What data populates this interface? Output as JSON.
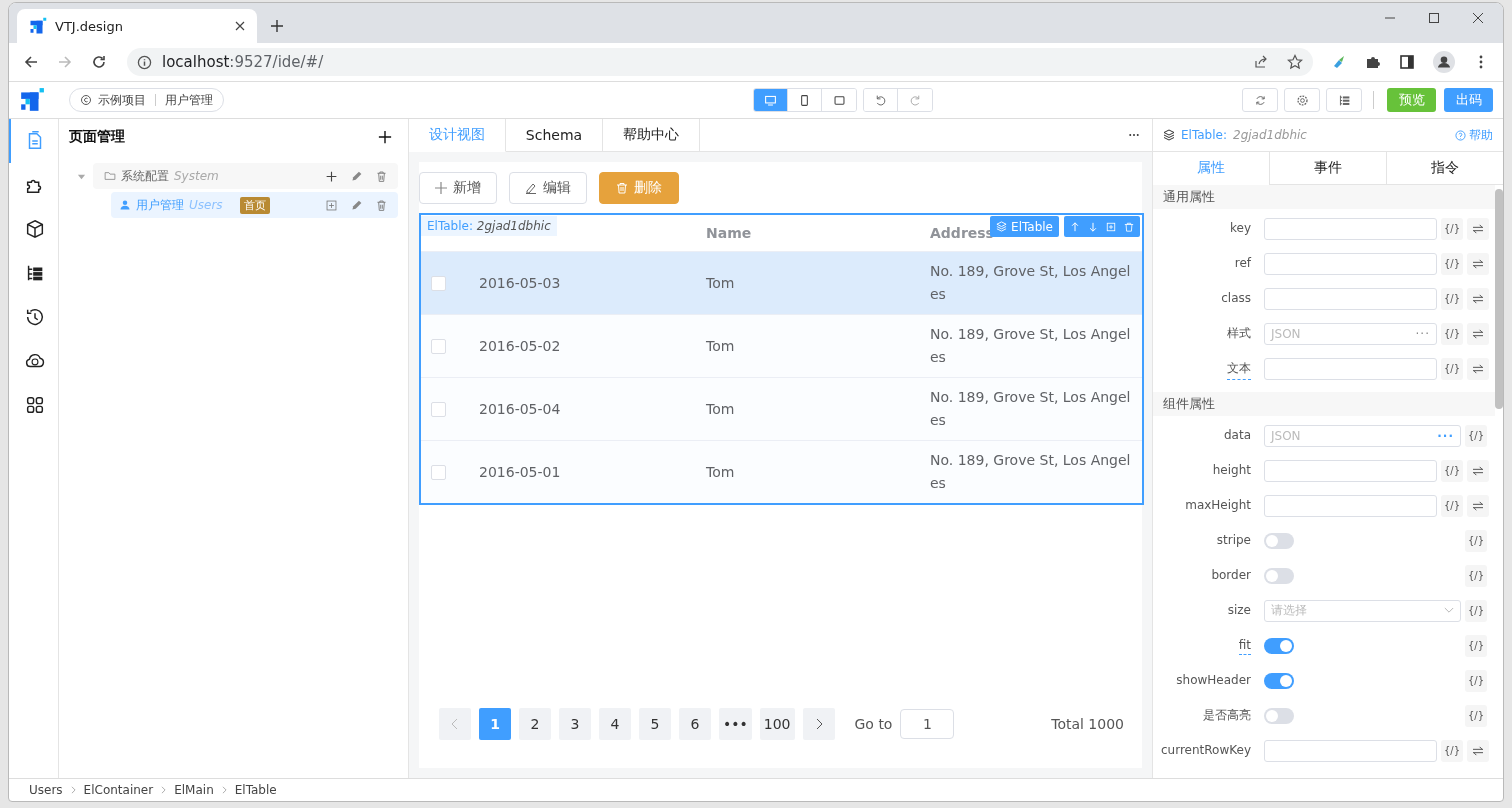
{
  "browser": {
    "tab_title": "VTJ.design",
    "url_host": "localhost",
    "url_rest": ":9527/ide/#/"
  },
  "toolbar": {
    "project": "示例项目",
    "page": "用户管理",
    "devices": [
      {
        "selected": true
      },
      {
        "selected": false
      },
      {
        "selected": false
      }
    ],
    "preview": "预览",
    "publish": "出码"
  },
  "sidebar_rail": {
    "items": [
      {
        "selected": true
      },
      {
        "selected": false
      },
      {
        "selected": false
      },
      {
        "selected": false
      },
      {
        "selected": false
      },
      {
        "selected": false
      },
      {
        "selected": false
      }
    ]
  },
  "pages_panel": {
    "title": "页面管理",
    "tree": [
      {
        "label": "系统配置",
        "name": "System",
        "kind": "folder",
        "expanded": true,
        "selected": false,
        "children": [
          {
            "label": "用户管理",
            "name": "Users",
            "kind": "page",
            "badge": "首页",
            "selected": true
          }
        ]
      }
    ]
  },
  "editor_tabs": [
    {
      "label": "设计视图",
      "selected": true
    },
    {
      "label": "Schema",
      "selected": false
    },
    {
      "label": "帮助中心",
      "selected": false
    }
  ],
  "canvas": {
    "buttons": [
      {
        "label": "新增",
        "kind": "add"
      },
      {
        "label": "编辑",
        "kind": "edit"
      },
      {
        "label": "删除",
        "kind": "delete"
      }
    ],
    "table": {
      "tag": "ElTable:",
      "id": "2gjad1dbhic",
      "badge": "ElTable",
      "columns": [
        "Name",
        "Address"
      ],
      "rows": [
        {
          "date": "2016-05-03",
          "name": "Tom",
          "address": "No. 189, Grove St, Los Angeles",
          "hovered": true,
          "checked": false
        },
        {
          "date": "2016-05-02",
          "name": "Tom",
          "address": "No. 189, Grove St, Los Angeles",
          "hovered": false,
          "checked": false
        },
        {
          "date": "2016-05-04",
          "name": "Tom",
          "address": "No. 189, Grove St, Los Angeles",
          "hovered": false,
          "checked": false
        },
        {
          "date": "2016-05-01",
          "name": "Tom",
          "address": "No. 189, Grove St, Los Angeles",
          "hovered": false,
          "checked": false
        }
      ]
    },
    "pagination": {
      "pages": [
        {
          "label": "1",
          "selected": true
        },
        {
          "label": "2",
          "selected": false
        },
        {
          "label": "3",
          "selected": false
        },
        {
          "label": "4",
          "selected": false
        },
        {
          "label": "5",
          "selected": false
        },
        {
          "label": "6",
          "selected": false
        },
        {
          "label": "•••",
          "selected": false
        },
        {
          "label": "100",
          "selected": false
        }
      ],
      "goto_label": "Go to",
      "goto_value": "1",
      "total": "Total 1000"
    }
  },
  "inspector": {
    "tag": "ElTable:",
    "id": "2gjad1dbhic",
    "help": "帮助",
    "bind_label": "{/}",
    "tabs": [
      {
        "label": "属性",
        "selected": true
      },
      {
        "label": "事件",
        "selected": false
      },
      {
        "label": "指令",
        "selected": false
      }
    ],
    "sections": [
      {
        "title": "通用属性",
        "rows": [
          {
            "label": "key",
            "kind": "input",
            "hint": false,
            "swap": true
          },
          {
            "label": "ref",
            "kind": "input",
            "hint": false,
            "swap": true
          },
          {
            "label": "class",
            "kind": "input",
            "hint": false,
            "swap": true
          },
          {
            "label": "样式",
            "kind": "json",
            "placeholder": "JSON",
            "more": "···",
            "hint": false,
            "swap": true
          },
          {
            "label": "文本",
            "kind": "input",
            "hint": true,
            "swap": true
          }
        ]
      },
      {
        "title": "组件属性",
        "rows": [
          {
            "label": "data",
            "kind": "json",
            "placeholder": "JSON",
            "more": "···",
            "hint": false
          },
          {
            "label": "height",
            "kind": "input",
            "hint": false,
            "swap": true
          },
          {
            "label": "maxHeight",
            "kind": "input",
            "hint": false,
            "swap": true
          },
          {
            "label": "stripe",
            "kind": "switch",
            "on": false,
            "hint": false
          },
          {
            "label": "border",
            "kind": "switch",
            "on": false,
            "hint": false
          },
          {
            "label": "size",
            "kind": "select",
            "placeholder": "请选择",
            "hint": false
          },
          {
            "label": "fit",
            "kind": "switch",
            "on": true,
            "hint": true
          },
          {
            "label": "showHeader",
            "kind": "switch",
            "on": true,
            "hint": false
          },
          {
            "label": "是否高亮",
            "kind": "switch",
            "on": false,
            "hint": false
          },
          {
            "label": "currentRowKey",
            "kind": "input",
            "hint": false,
            "swap": true
          }
        ]
      }
    ]
  },
  "status_bar": {
    "path": [
      "Users",
      "ElContainer",
      "ElMain",
      "ElTable"
    ]
  }
}
